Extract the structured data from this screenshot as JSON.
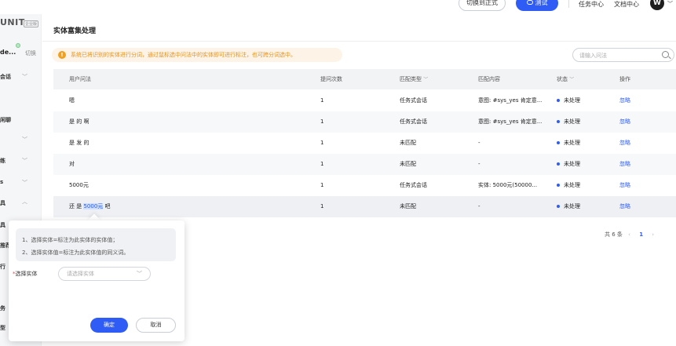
{
  "topbar": {
    "switch_label": "切换到正式",
    "test_label": "测试",
    "task_center": "任务中心",
    "doc_center": "文档中心",
    "avatar_letter": "W"
  },
  "sidebar": {
    "brand": "UNIT",
    "brand_badge": "企业版",
    "project_name": "de...",
    "project_switch": "切换",
    "items": [
      {
        "label": "会话",
        "chevron": true
      },
      {
        "label": "",
        "chevron": false
      },
      {
        "label": "闲聊",
        "chevron": false
      },
      {
        "label": "",
        "chevron": true
      },
      {
        "label": "练",
        "chevron": true
      },
      {
        "label": "s",
        "chevron": true
      },
      {
        "label": "具",
        "chevron": true
      },
      {
        "label": "具",
        "chevron": false
      },
      {
        "label": "推荐",
        "chevron": false
      },
      {
        "label": "行",
        "chevron": false
      },
      {
        "label": "务",
        "chevron": false
      },
      {
        "label": "型",
        "chevron": false
      }
    ]
  },
  "page": {
    "title": "实体富集处理",
    "notice": "系统已将识别的实体进行分词，通过鼠标选中问法中的实体即可进行标注，也可跨分词选中。",
    "search_placeholder": "请输入问法"
  },
  "table": {
    "headers": [
      "用户问法",
      "提问次数",
      "匹配类型",
      "匹配内容",
      "状态",
      "操作"
    ],
    "rows": [
      {
        "query": "嗯",
        "count": "1",
        "type": "任务式会话",
        "content": "意图: #sys_yes 肯定意...",
        "status": "未处理",
        "action": "忽略"
      },
      {
        "query": "是 的 啊",
        "count": "1",
        "type": "任务式会话",
        "content": "意图: #sys_yes 肯定意...",
        "status": "未处理",
        "action": "忽略"
      },
      {
        "query": "是 发 的",
        "count": "1",
        "type": "未匹配",
        "content": "-",
        "status": "未处理",
        "action": "忽略"
      },
      {
        "query": "对",
        "count": "1",
        "type": "未匹配",
        "content": "-",
        "status": "未处理",
        "action": "忽略"
      },
      {
        "query": "5000元",
        "count": "1",
        "type": "任务式会话",
        "content": "实体: 5000元(50000...",
        "status": "未处理",
        "action": "忽略"
      },
      {
        "query_pre": "还 是 ",
        "query_hl": "5000元",
        "query_post": " 吧",
        "count": "1",
        "type": "未匹配",
        "content": "-",
        "status": "未处理",
        "action": "忽略"
      }
    ]
  },
  "pager": {
    "total": "共 6 条",
    "current": "1"
  },
  "popover": {
    "hint_line1": "1、选择实体=标注为此实体的实体值；",
    "hint_line2": "2、选择实体值=标注为此实体值的同义词。",
    "label_required": "*",
    "label": "选择实体",
    "select_placeholder": "请选择实体",
    "ok_label": "确定",
    "cancel_label": "取消"
  },
  "colors": {
    "primary": "#2f5cf5",
    "warning": "#e8901c"
  }
}
